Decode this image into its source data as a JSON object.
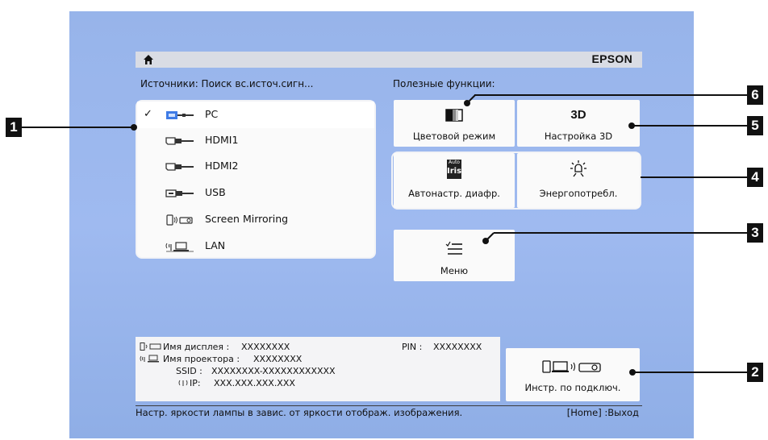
{
  "topbar": {
    "brand": "EPSON",
    "home_icon": "home-icon"
  },
  "sources": {
    "heading": "Источники: Поиск вс.источ.сигн...",
    "items": [
      {
        "label": "PC",
        "icon": "pc-source-icon",
        "selected": true,
        "check": "✓"
      },
      {
        "label": "HDMI1",
        "icon": "hdmi-icon",
        "selected": false,
        "check": ""
      },
      {
        "label": "HDMI2",
        "icon": "hdmi-icon",
        "selected": false,
        "check": ""
      },
      {
        "label": "USB",
        "icon": "usb-icon",
        "selected": false,
        "check": ""
      },
      {
        "label": "Screen Mirroring",
        "icon": "screen-mirroring-icon",
        "selected": false,
        "check": ""
      },
      {
        "label": "LAN",
        "icon": "lan-icon",
        "selected": false,
        "check": ""
      }
    ]
  },
  "functions": {
    "heading": "Полезные функции:",
    "color_mode": {
      "label": "Цветовой режим",
      "icon": "color-mode-icon"
    },
    "setting_3d": {
      "label": "Настройка 3D",
      "icon_text": "3D",
      "icon": "3d-icon"
    },
    "auto_iris": {
      "label": "Автонастр. диафр.",
      "icon_top": "Auto",
      "icon_bottom": "Iris",
      "icon": "auto-iris-icon"
    },
    "power": {
      "label": "Энергопотребл.",
      "icon": "power-consumption-icon"
    },
    "menu": {
      "label": "Меню",
      "icon": "menu-icon"
    },
    "connection_guide": {
      "label": "Инстр. по подключ.",
      "icon": "connection-guide-icon"
    }
  },
  "info": {
    "display_name_label": "Имя дисплея :",
    "display_name_value": "XXXXXXXX",
    "pin_label": "PIN :",
    "pin_value": "XXXXXXXX",
    "projector_name_label": "Имя проектора :",
    "projector_name_value": "XXXXXXXX",
    "ssid_label": "SSID :",
    "ssid_value": "XXXXXXXX-XXXXXXXXXXXX",
    "ip_label": "IP:",
    "ip_value": "XXX.XXX.XXX.XXX"
  },
  "status": {
    "message": "Настр. яркости лампы в завис. от яркости отображ. изображения.",
    "exit": "[Home] :Выход"
  },
  "callouts": [
    "1",
    "2",
    "3",
    "4",
    "5",
    "6"
  ],
  "colors": {
    "screen_bg": "#9bb7ee",
    "panel_bg": "#fafafa",
    "callout_bg": "#111111"
  }
}
